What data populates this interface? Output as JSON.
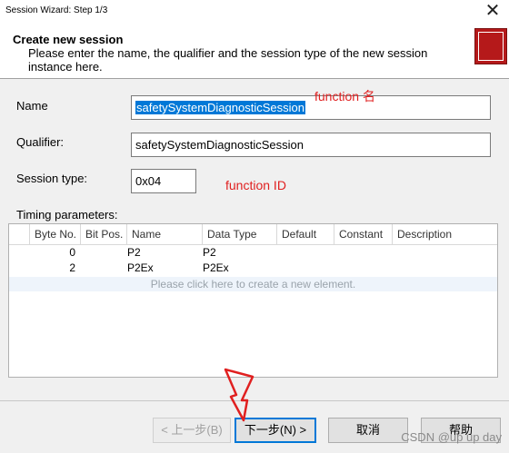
{
  "window": {
    "title": "Session Wizard: Step 1/3",
    "close_glyph": "✕"
  },
  "header": {
    "title": "Create new session",
    "description": "Please enter the name, the qualifier and the session type of the new session instance here."
  },
  "form": {
    "name_label": "Name",
    "name_value": "safetySystemDiagnosticSession",
    "qualifier_label": "Qualifier:",
    "qualifier_value": "safetySystemDiagnosticSession",
    "session_type_label": "Session type:",
    "session_type_value": "0x04"
  },
  "annotations": {
    "name_note": "function 名",
    "type_note": "function ID"
  },
  "timing": {
    "label": "Timing parameters:",
    "columns": [
      "Byte No.",
      "Bit Pos.",
      "Name",
      "Data Type",
      "Default",
      "Constant",
      "Description"
    ],
    "rows": [
      {
        "byte_no": "0",
        "bit_pos": "",
        "name": "P2",
        "data_type": "P2",
        "default": "",
        "constant": "",
        "description": ""
      },
      {
        "byte_no": "2",
        "bit_pos": "",
        "name": "P2Ex",
        "data_type": "P2Ex",
        "default": "",
        "constant": "",
        "description": ""
      }
    ],
    "new_row_hint": "Please click here to create a new element."
  },
  "buttons": {
    "back": "< 上一步(B)",
    "next": "下一步(N) >",
    "cancel": "取消",
    "help": "帮助"
  },
  "watermark": "CSDN @up up day",
  "colors": {
    "selection": "#0078d7",
    "annotation": "#e02020",
    "icon": "#b5191a"
  }
}
